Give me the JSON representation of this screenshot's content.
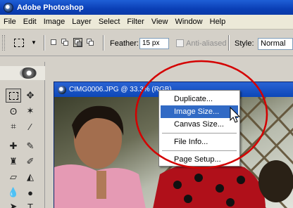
{
  "window": {
    "title": "Adobe Photoshop"
  },
  "menubar": [
    "File",
    "Edit",
    "Image",
    "Layer",
    "Select",
    "Filter",
    "View",
    "Window",
    "Help"
  ],
  "options": {
    "feather_label": "Feather:",
    "feather_value": "15 px",
    "antialiased_label": "Anti-aliased",
    "style_label": "Style:",
    "style_value": "Normal"
  },
  "document": {
    "title": "CIMG0006.JPG @ 33.3% (RGB)"
  },
  "context_menu": {
    "items": [
      "Duplicate...",
      "Image Size...",
      "Canvas Size...",
      "File Info...",
      "Page Setup..."
    ],
    "highlighted": "Image Size..."
  },
  "colors": {
    "highlight": "#316ac5",
    "annotation_circle": "#d40000",
    "title_blue": "#0a3fb6"
  },
  "icons": [
    "photoshop-logo-icon",
    "rect-marquee-icon",
    "move-icon",
    "lasso-icon",
    "magic-wand-icon",
    "crop-icon",
    "slice-icon",
    "healing-brush-icon",
    "brush-icon",
    "clone-stamp-icon",
    "history-brush-icon",
    "eraser-icon",
    "paint-bucket-icon",
    "blur-icon",
    "dodge-icon",
    "path-select-icon",
    "type-icon"
  ]
}
